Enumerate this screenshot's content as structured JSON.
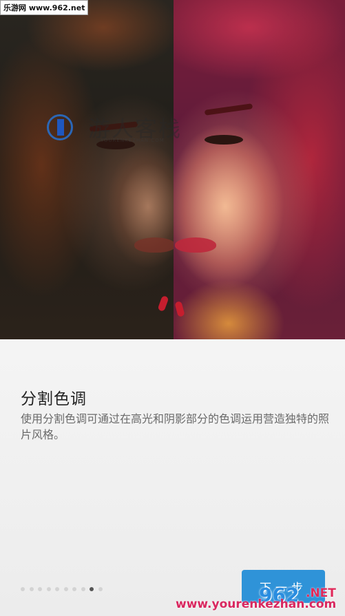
{
  "overlay": {
    "site_tag": "乐游网 www.962.net",
    "watermark_text": "游人客栈",
    "watermark_sub": "YOURENKEZHAN.COM",
    "bottom_url": "www.yourenkezhan.com",
    "logo_num": "962",
    "logo_net": ".NET"
  },
  "onboarding": {
    "title": "分割色调",
    "description": "使用分割色调可通过在高光和阴影部分的色调运用营造独特的照片风格。",
    "page_count": 10,
    "active_page": 8,
    "next_label": "下一步"
  },
  "colors": {
    "accent": "#2f93d8",
    "dot_inactive": "#d3d3d3",
    "dot_active": "#555555"
  }
}
